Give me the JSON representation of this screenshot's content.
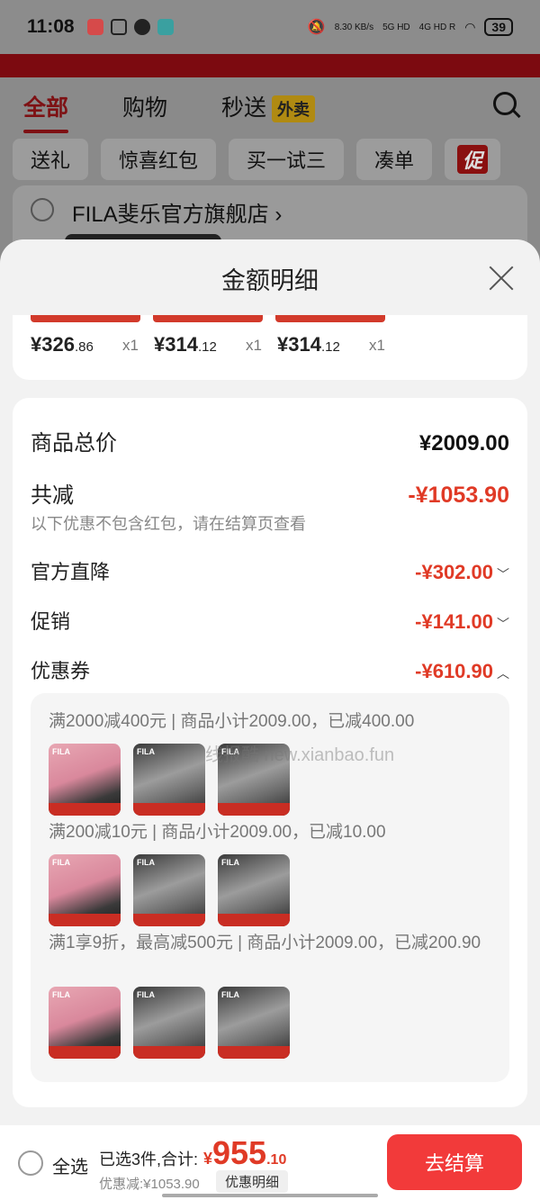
{
  "status_bar": {
    "time": "11:08",
    "net_speed": "8.30 KB/s",
    "signal1": "5G HD",
    "signal2": "4G HD R",
    "battery": "39"
  },
  "background_page": {
    "tabs": [
      "全部",
      "购物",
      "秒送"
    ],
    "waimai_badge": "外卖",
    "chips": [
      "送礼",
      "惊喜红包",
      "买一试三",
      "凑单"
    ],
    "promo_chip": "促",
    "store_name": "FILA斐乐官方旗舰店",
    "store_chevron": "›"
  },
  "sheet": {
    "title": "金额明细",
    "items": [
      {
        "price_int": "¥326",
        "price_dec": ".86",
        "qty": "x1"
      },
      {
        "price_int": "¥314",
        "price_dec": ".12",
        "qty": "x1"
      },
      {
        "price_int": "¥314",
        "price_dec": ".12",
        "qty": "x1"
      }
    ],
    "total_label": "商品总价",
    "total_value": "¥2009.00",
    "discount_label": "共减",
    "discount_value": "-¥1053.90",
    "discount_note": "以下优惠不包含红包，请在结算页查看",
    "lines": [
      {
        "label": "官方直降",
        "value": "-¥302.00",
        "chevron": "﹀"
      },
      {
        "label": "促销",
        "value": "-¥141.00",
        "chevron": "﹀"
      },
      {
        "label": "优惠券",
        "value": "-¥610.90",
        "chevron": "︿"
      }
    ],
    "coupon_rules": [
      "满2000减400元 | 商品小计2009.00，已减400.00",
      "满200减10元 | 商品小计2009.00，已减10.00",
      "满1享9折，最高减500元 | 商品小计2009.00，已减200.90"
    ],
    "thumb_brand": "FILA"
  },
  "watermark": "线报酷 new.xianbao.fun",
  "bottom_bar": {
    "select_all": "全选",
    "summary": "已选3件,合计:",
    "currency": "¥",
    "total_int": "955",
    "total_dec": ".10",
    "saved": "优惠减:¥1053.90",
    "detail_button": "优惠明细",
    "checkout_button": "去结算"
  },
  "colors": {
    "accent_red": "#e03a26",
    "checkout_red": "#f23a3a"
  }
}
